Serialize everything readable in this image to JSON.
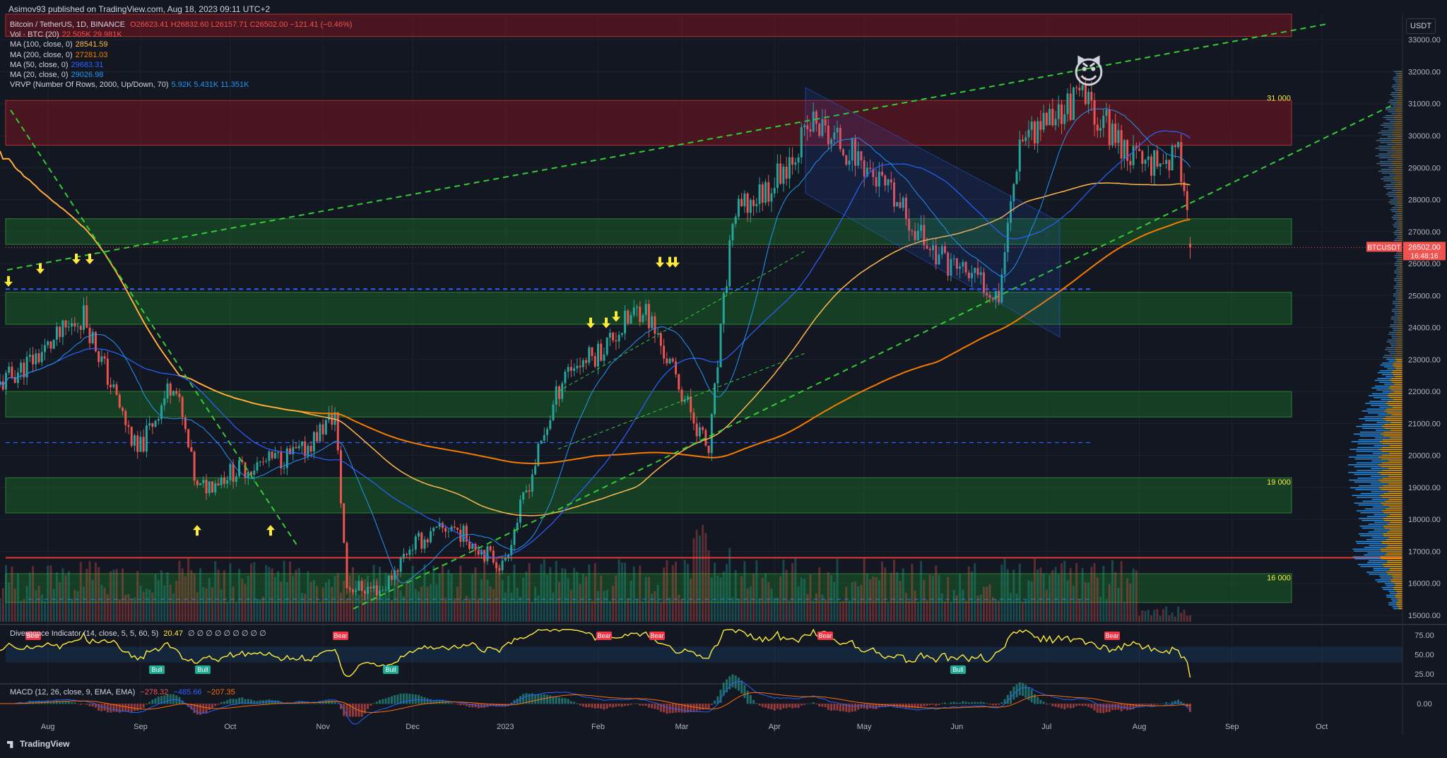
{
  "header": {
    "published": "Asimov93 published on TradingView.com, Aug 18, 2023 09:11 UTC+2"
  },
  "legend": {
    "symbol": "Bitcoin / TetherUS, 1D, BINANCE",
    "ohlc": "O26623.41 H26832.60 L26157.71 C26502.00 −121.41 (−0.46%)",
    "indicators": [
      {
        "label": "Vol · BTC (20)",
        "values": "22.505K  29.981K",
        "color": "#ef5350"
      },
      {
        "label": "MA (100, close, 0)",
        "values": "28541.59",
        "color": "#ffb74d"
      },
      {
        "label": "MA (200, close, 0)",
        "values": "27281.03",
        "color": "#f57c00"
      },
      {
        "label": "MA (50, close, 0)",
        "values": "29683.31",
        "color": "#2962ff"
      },
      {
        "label": "MA (20, close, 0)",
        "values": "29026.98",
        "color": "#2196f3"
      },
      {
        "label": "VRVP (Number Of Rows, 2000, Up/Down, 70)",
        "values": "5.92K  5.431K  11.351K",
        "color": "#2196f3"
      }
    ]
  },
  "divergence_legend": {
    "label": "Divergence Indicator (14, close, 5, 5, 60, 5)",
    "value": "20.47",
    "rest": "∅ ∅ ∅ ∅ ∅ ∅ ∅ ∅ ∅"
  },
  "macd_legend": {
    "label": "MACD (12, 26, close, 9, EMA, EMA)",
    "v1": "−278.32",
    "v2": "−485.66",
    "v3": "−207.35"
  },
  "price_scale": {
    "unit": "USDT",
    "ticks": [
      "33000.00",
      "32000.00",
      "31000.00",
      "30000.00",
      "29000.00",
      "28000.00",
      "27000.00",
      "26000.00",
      "25000.00",
      "24000.00",
      "23000.00",
      "22000.00",
      "21000.00",
      "20000.00",
      "19000.00",
      "18000.00",
      "17000.00",
      "16000.00",
      "15000.00"
    ],
    "symbol_tag": "BTCUSDT",
    "last_price": "26502.00",
    "countdown": "16:48:16"
  },
  "osc_scale": {
    "ticks": [
      "75.00",
      "50.00",
      "25.00"
    ]
  },
  "macd_scale": {
    "ticks": [
      "0.00"
    ]
  },
  "time_axis": {
    "labels": [
      "Aug",
      "Sep",
      "Oct",
      "Nov",
      "Dec",
      "2023",
      "Feb",
      "Mar",
      "Apr",
      "May",
      "Jun",
      "Jul",
      "Aug",
      "Sep",
      "Oct"
    ]
  },
  "annotations": {
    "level_31000": "31 000",
    "level_19000": "19 000",
    "level_16000": "16 000",
    "bear": "Bear",
    "bull": "Bull"
  },
  "brand": {
    "tradingview": "TradingView"
  },
  "colors": {
    "up": "#26a69a",
    "down": "#ef5350",
    "bg": "#131722",
    "green_zone": "#1b5e20",
    "red_zone": "#7f1d1d",
    "dashed_green": "#32cd32"
  },
  "chart_data": {
    "type": "candlestick",
    "title": "Bitcoin / TetherUS, 1D, BINANCE",
    "xlabel": "",
    "ylabel": "USDT",
    "ylim": [
      14800,
      33800
    ],
    "x_range": [
      "2022-07-16",
      "2023-10-28"
    ],
    "monthly_closes": [
      {
        "month": "2022-07",
        "close": 23300
      },
      {
        "month": "2022-08",
        "close": 20050
      },
      {
        "month": "2022-09",
        "close": 19430
      },
      {
        "month": "2022-10",
        "close": 20490
      },
      {
        "month": "2022-11",
        "close": 17160
      },
      {
        "month": "2022-12",
        "close": 16540
      },
      {
        "month": "2023-01",
        "close": 23130
      },
      {
        "month": "2023-02",
        "close": 23150
      },
      {
        "month": "2023-03",
        "close": 28480
      },
      {
        "month": "2023-04",
        "close": 29230
      },
      {
        "month": "2023-05",
        "close": 27210
      },
      {
        "month": "2023-06",
        "close": 30470
      },
      {
        "month": "2023-07",
        "close": 29230
      },
      {
        "month": "2023-08-18",
        "close": 26502
      }
    ],
    "horizontal_levels": [
      31000,
      19000,
      16000,
      25200,
      20400
    ],
    "zones": [
      {
        "type": "resistance",
        "from": 33100,
        "to": 34300
      },
      {
        "type": "resistance",
        "from": 29700,
        "to": 31100
      },
      {
        "type": "support",
        "from": 26600,
        "to": 27400
      },
      {
        "type": "support",
        "from": 24100,
        "to": 25100
      },
      {
        "type": "support",
        "from": 21200,
        "to": 22000
      },
      {
        "type": "support",
        "from": 18200,
        "to": 19300
      },
      {
        "type": "support",
        "from": 15400,
        "to": 16300
      }
    ],
    "vrvp_poc": 16800,
    "oscillator": {
      "name": "Divergence Indicator",
      "last": 20.47,
      "ylim": [
        15,
        85
      ]
    },
    "macd": {
      "macd": -278.32,
      "signal": -485.66,
      "hist": -207.35
    }
  }
}
